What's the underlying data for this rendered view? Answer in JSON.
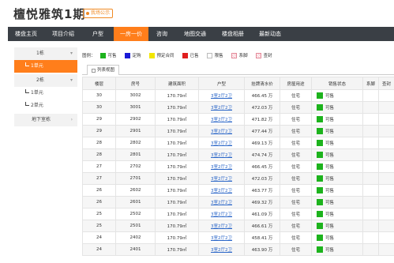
{
  "header": {
    "title": "檀悦雅筑1期",
    "badge": "我场公示"
  },
  "nav": {
    "items": [
      {
        "label": "楼盘主页"
      },
      {
        "label": "项目介绍"
      },
      {
        "label": "户型"
      },
      {
        "label": "一房一价",
        "active": true
      },
      {
        "label": "咨询"
      },
      {
        "label": "地图交通"
      },
      {
        "label": "楼盘相册"
      },
      {
        "label": "最新动态"
      }
    ]
  },
  "sidebar": {
    "building1": "1栋",
    "building1_unit": "1单元",
    "building2": "2栋",
    "building2_unit1": "1单元",
    "building2_unit2": "2单元",
    "basement": "地下室栋"
  },
  "legend": {
    "label": "图例：",
    "items": [
      {
        "name": "可售",
        "color": "#1db31d"
      },
      {
        "name": "定购",
        "color": "#1a1ad6"
      },
      {
        "name": "预定合同",
        "color": "#f2e600"
      },
      {
        "name": "已售",
        "color": "#e01e1e"
      },
      {
        "name": "限售",
        "color": "#ffffff"
      },
      {
        "name": "系脚",
        "color": "#f7c6ce"
      },
      {
        "name": "查封",
        "color": "#f7c6ce"
      }
    ]
  },
  "view_tab": "列表视图",
  "table": {
    "headers": [
      "楼层",
      "房号",
      "建筑面积",
      "户型",
      "挂牌清水价",
      "房屋用途",
      "销售状态",
      "系脚",
      "查封"
    ],
    "rows": [
      [
        "30",
        "3002",
        "170.79㎡",
        "3室2厅2卫",
        "466.45 万",
        "住宅",
        "可售",
        "",
        ""
      ],
      [
        "30",
        "3001",
        "170.79㎡",
        "3室2厅2卫",
        "472.03 万",
        "住宅",
        "可售",
        "",
        ""
      ],
      [
        "29",
        "2902",
        "170.79㎡",
        "3室2厅2卫",
        "471.82 万",
        "住宅",
        "可售",
        "",
        ""
      ],
      [
        "29",
        "2901",
        "170.79㎡",
        "3室2厅2卫",
        "477.44 万",
        "住宅",
        "可售",
        "",
        ""
      ],
      [
        "28",
        "2802",
        "170.79㎡",
        "3室2厅2卫",
        "469.13 万",
        "住宅",
        "可售",
        "",
        ""
      ],
      [
        "28",
        "2801",
        "170.79㎡",
        "3室2厅2卫",
        "474.74 万",
        "住宅",
        "可售",
        "",
        ""
      ],
      [
        "27",
        "2702",
        "170.79㎡",
        "3室2厅2卫",
        "466.45 万",
        "住宅",
        "可售",
        "",
        ""
      ],
      [
        "27",
        "2701",
        "170.79㎡",
        "3室2厅2卫",
        "472.03 万",
        "住宅",
        "可售",
        "",
        ""
      ],
      [
        "26",
        "2602",
        "170.79㎡",
        "3室2厅2卫",
        "463.77 万",
        "住宅",
        "可售",
        "",
        ""
      ],
      [
        "26",
        "2601",
        "170.79㎡",
        "3室2厅2卫",
        "469.32 万",
        "住宅",
        "可售",
        "",
        ""
      ],
      [
        "25",
        "2502",
        "170.79㎡",
        "3室2厅2卫",
        "461.09 万",
        "住宅",
        "可售",
        "",
        ""
      ],
      [
        "25",
        "2501",
        "170.79㎡",
        "3室2厅2卫",
        "466.61 万",
        "住宅",
        "可售",
        "",
        ""
      ],
      [
        "24",
        "2402",
        "170.79㎡",
        "3室2厅2卫",
        "458.41 万",
        "住宅",
        "可售",
        "",
        ""
      ],
      [
        "24",
        "2401",
        "170.79㎡",
        "3室2厅2卫",
        "463.90 万",
        "住宅",
        "可售",
        "",
        ""
      ]
    ],
    "status_color": "#1db31d"
  }
}
